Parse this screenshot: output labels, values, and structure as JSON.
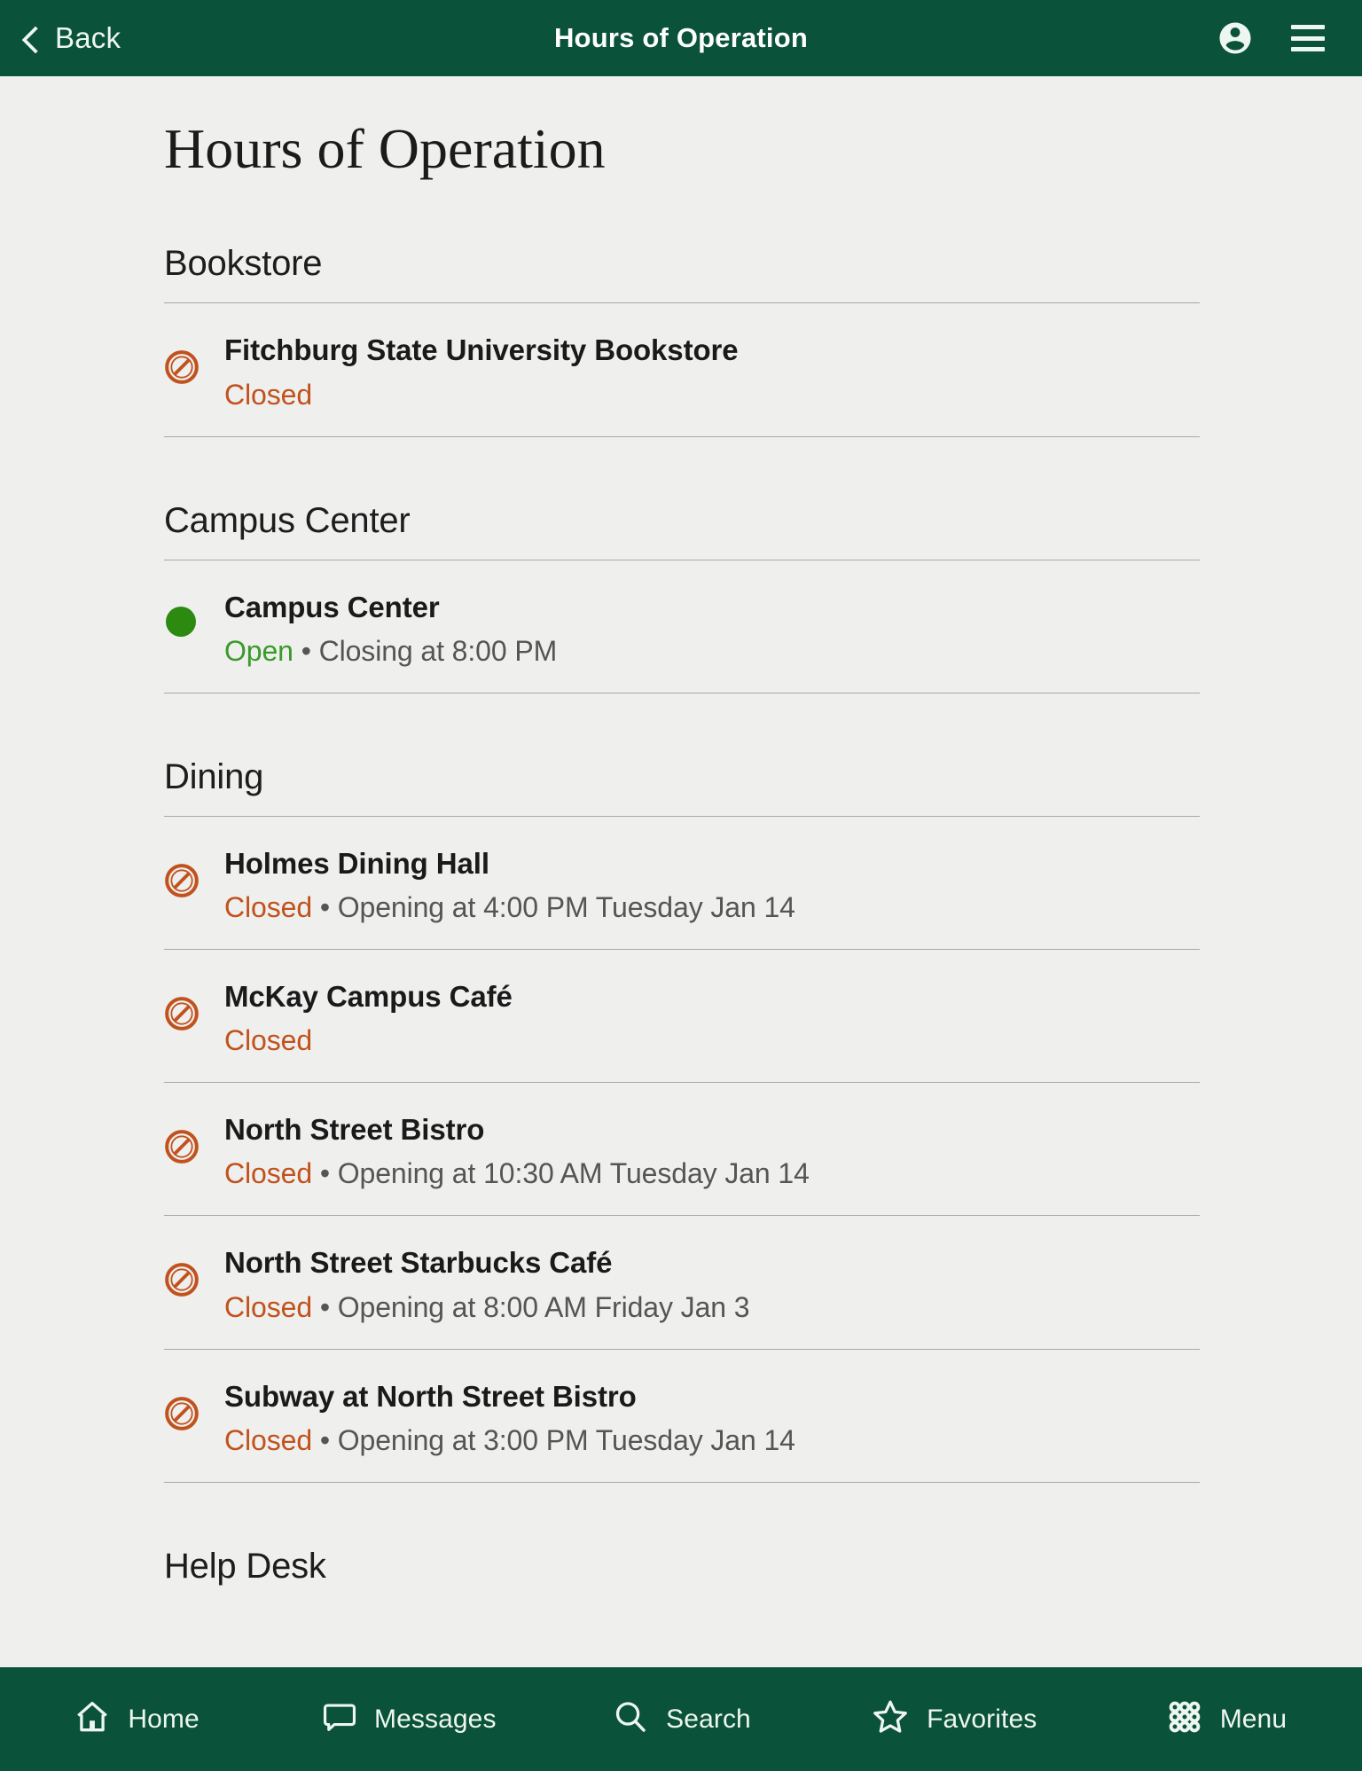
{
  "top_bar": {
    "back_label": "Back",
    "title": "Hours of Operation",
    "account_icon": "account-circle-icon",
    "menu_icon": "hamburger-menu-icon",
    "background_color": "#0a5239"
  },
  "page": {
    "title": "Hours of Operation",
    "background_color": "#efefee"
  },
  "status_colors": {
    "closed": "#c1521d",
    "open": "#3a9a2a",
    "open_dot": "#2b8a0f",
    "detail": "#555555"
  },
  "sections": [
    {
      "header": "Bookstore",
      "rows": [
        {
          "name": "Fitchburg State University Bookstore",
          "status": "Closed",
          "status_type": "closed",
          "icon": "prohibition-closed-icon",
          "separator": "",
          "detail": ""
        }
      ]
    },
    {
      "header": "Campus Center",
      "rows": [
        {
          "name": "Campus Center",
          "status": "Open",
          "status_type": "open",
          "icon": "green-dot-open-icon",
          "separator": "•",
          "detail": "Closing at 8:00 PM"
        }
      ]
    },
    {
      "header": "Dining",
      "rows": [
        {
          "name": "Holmes Dining Hall",
          "status": "Closed",
          "status_type": "closed",
          "icon": "prohibition-closed-icon",
          "separator": "•",
          "detail": "Opening at 4:00 PM Tuesday Jan 14"
        },
        {
          "name": "McKay Campus Café",
          "status": "Closed",
          "status_type": "closed",
          "icon": "prohibition-closed-icon",
          "separator": "",
          "detail": ""
        },
        {
          "name": "North Street Bistro",
          "status": "Closed",
          "status_type": "closed",
          "icon": "prohibition-closed-icon",
          "separator": "•",
          "detail": "Opening at 10:30 AM Tuesday Jan 14"
        },
        {
          "name": "North Street Starbucks Café",
          "status": "Closed",
          "status_type": "closed",
          "icon": "prohibition-closed-icon",
          "separator": "•",
          "detail": "Opening at 8:00 AM Friday Jan 3"
        },
        {
          "name": "Subway at North Street Bistro",
          "status": "Closed",
          "status_type": "closed",
          "icon": "prohibition-closed-icon",
          "separator": "•",
          "detail": "Opening at 3:00 PM Tuesday Jan 14"
        }
      ]
    },
    {
      "header": "Help Desk",
      "rows": []
    }
  ],
  "bottom_nav": {
    "background_color": "#0a5239",
    "items": [
      {
        "label": "Home",
        "icon": "home-icon"
      },
      {
        "label": "Messages",
        "icon": "message-bubble-icon"
      },
      {
        "label": "Search",
        "icon": "search-icon"
      },
      {
        "label": "Favorites",
        "icon": "star-icon"
      },
      {
        "label": "Menu",
        "icon": "grid-dots-icon"
      }
    ]
  }
}
